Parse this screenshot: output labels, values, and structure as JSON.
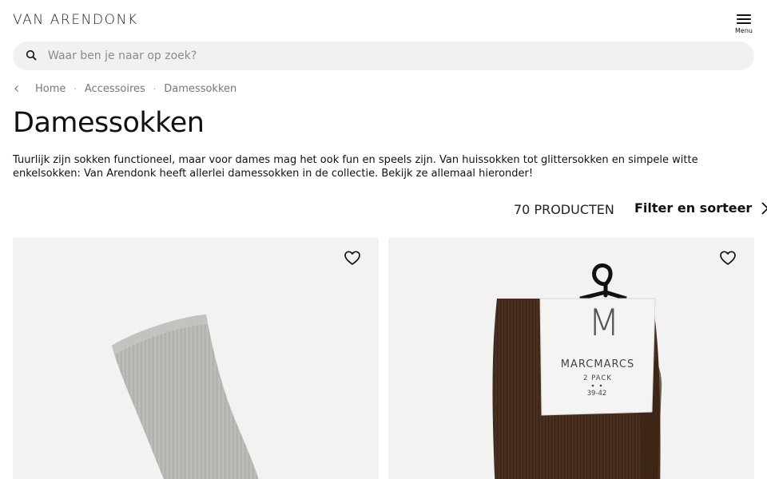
{
  "header": {
    "logo": "VAN ARENDONK",
    "menu_label": "Menu"
  },
  "search": {
    "placeholder": "Waar ben je naar op zoek?"
  },
  "breadcrumb": {
    "items": [
      "Home",
      "Accessoires",
      "Damessokken"
    ],
    "separator": "·"
  },
  "page": {
    "title": "Damessokken",
    "intro": "Tuurlijk zijn sokken functioneel, maar voor dames mag het ook fun en speels zijn. Van huissokken tot glittersokken en simpele witte enkelsokken: Van Arendonk heeft allerlei damessokken in de collectie. Bekijk ze allemaal hieronder!"
  },
  "toolbar": {
    "count": "70 PRODUCTEN",
    "filter_label": "Filter en sorteer"
  },
  "products": [
    {
      "image_label": "grey-ribbed-sock",
      "favorite_icon": "heart-icon"
    },
    {
      "image_label": "brown-socks-2-pack",
      "favorite_icon": "heart-icon",
      "tag_brand": "MARCMARCS",
      "tag_monogram": "M",
      "tag_pack": "2 PACK",
      "tag_size": "39-42"
    }
  ],
  "colors": {
    "text": "#111111",
    "muted": "#777777",
    "search_bg": "#f1f1f1",
    "card_bg": "#f2f2f2",
    "sock_grey": "#b9b8b5",
    "sock_brown": "#4a2f1f"
  }
}
